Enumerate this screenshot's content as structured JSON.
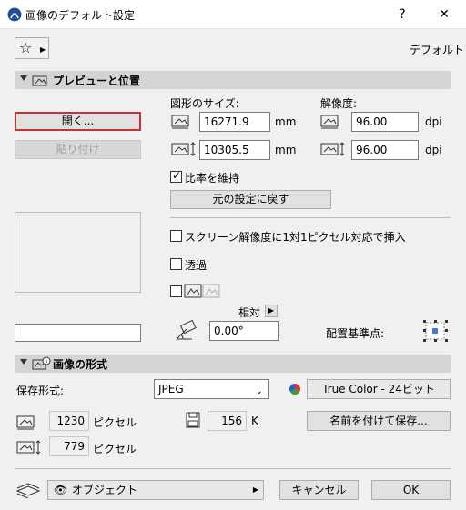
{
  "window": {
    "title": "画像のデフォルト設定",
    "help": "?",
    "close": "✕"
  },
  "preset": {
    "label": "デフォルト"
  },
  "preview_section": {
    "title": "プレビューと位置"
  },
  "buttons": {
    "open": "開く...",
    "paste": "貼り付け",
    "reset": "元の設定に戻す"
  },
  "size": {
    "label": "図形のサイズ:",
    "width": "16271.9",
    "height": "10305.5",
    "unit": "mm"
  },
  "resolution": {
    "label": "解像度:",
    "x": "96.00",
    "y": "96.00",
    "unit": "dpi"
  },
  "options": {
    "keep_ratio": {
      "label": "比率を維持",
      "checked": true
    },
    "screen_res": {
      "label": "スクリーン解像度に1対1ピクセル対応で挿入",
      "checked": false
    },
    "transparent": {
      "label": "透過",
      "checked": false
    }
  },
  "rotation": {
    "relative_label": "相対",
    "angle": "0.00°"
  },
  "anchor": {
    "label": "配置基準点:"
  },
  "format_section": {
    "title": "画像の形式"
  },
  "format": {
    "save_label": "保存形式:",
    "type": "JPEG",
    "color_depth": "True Color - 24ビット",
    "px_w": "1230",
    "px_h": "779",
    "px_unit": "ピクセル",
    "file_size": "156",
    "file_unit": "K",
    "save_as": "名前を付けて保存..."
  },
  "footer": {
    "layer": "オブジェクト",
    "cancel": "キャンセル",
    "ok": "OK"
  }
}
